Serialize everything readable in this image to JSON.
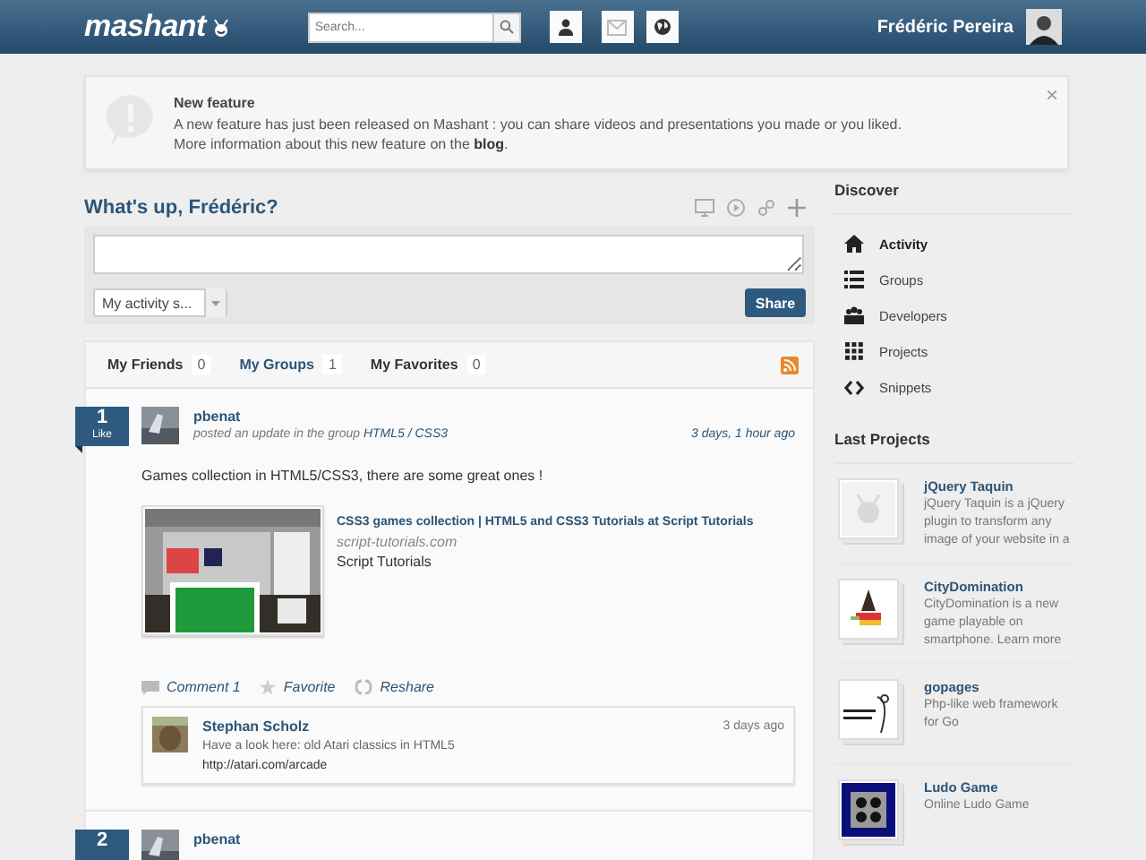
{
  "header": {
    "logo": "mashant",
    "search": {
      "placeholder": "Search..."
    },
    "user_name": "Frédéric Pereira"
  },
  "notice": {
    "title": "New feature",
    "lines": [
      "A new feature has just been released on Mashant : you can share videos and presentations you made or you liked.",
      "More information about this new feature on the **blog**."
    ],
    "close": "×"
  },
  "composer": {
    "title": "What's up, Frédéric?",
    "visibility": "My activity s...",
    "share": "Share"
  },
  "filter_tabs": [
    {
      "label": "My Friends",
      "count": "0",
      "selected": false
    },
    {
      "label": "My Groups",
      "count": "1",
      "selected": true
    },
    {
      "label": "My Favorites",
      "count": "0",
      "selected": false
    }
  ],
  "posts": [
    {
      "likes": "1",
      "like_label": "Like",
      "author": "pbenat",
      "action": "posted an update in the group",
      "group": "HTML5 / CSS3",
      "time": "3 days, 1 hour ago",
      "text": "Games collection in HTML5/CSS3, there are some great ones !",
      "link": {
        "title": "CSS3 games collection | HTML5 and CSS3 Tutorials at Script Tutorials",
        "domain": "script-tutorials.com",
        "site": "Script Tutorials"
      },
      "actions": [
        {
          "kind": "comment",
          "label": "Comment 1"
        },
        {
          "kind": "favorite",
          "label": "Favorite"
        },
        {
          "kind": "reshare",
          "label": "Reshare"
        }
      ],
      "comments": [
        {
          "author": "Stephan Scholz",
          "time": "3 days ago",
          "text": "Have a look here: old Atari classics in HTML5",
          "url": "http://atari.com/arcade"
        }
      ]
    },
    {
      "likes": "2",
      "author": "pbenat"
    }
  ],
  "sidebar": {
    "discover_title": "Discover",
    "discover": [
      {
        "kind": "activity",
        "label": "Activity",
        "selected": true
      },
      {
        "kind": "groups",
        "label": "Groups",
        "selected": false
      },
      {
        "kind": "developers",
        "label": "Developers",
        "selected": false
      },
      {
        "kind": "projects",
        "label": "Projects",
        "selected": false
      },
      {
        "kind": "snippets",
        "label": "Snippets",
        "selected": false
      }
    ],
    "projects_title": "Last Projects",
    "projects": [
      {
        "name": "jQuery Taquin",
        "description": "jQuery Taquin is a jQuery plugin to transform any image of your website in a"
      },
      {
        "name": "CityDomination",
        "description": "CityDomination is a new game playable on smartphone. Learn more"
      },
      {
        "name": "gopages",
        "description": "Php-like web framework for Go"
      },
      {
        "name": "Ludo Game",
        "description": "Online Ludo Game"
      }
    ]
  }
}
